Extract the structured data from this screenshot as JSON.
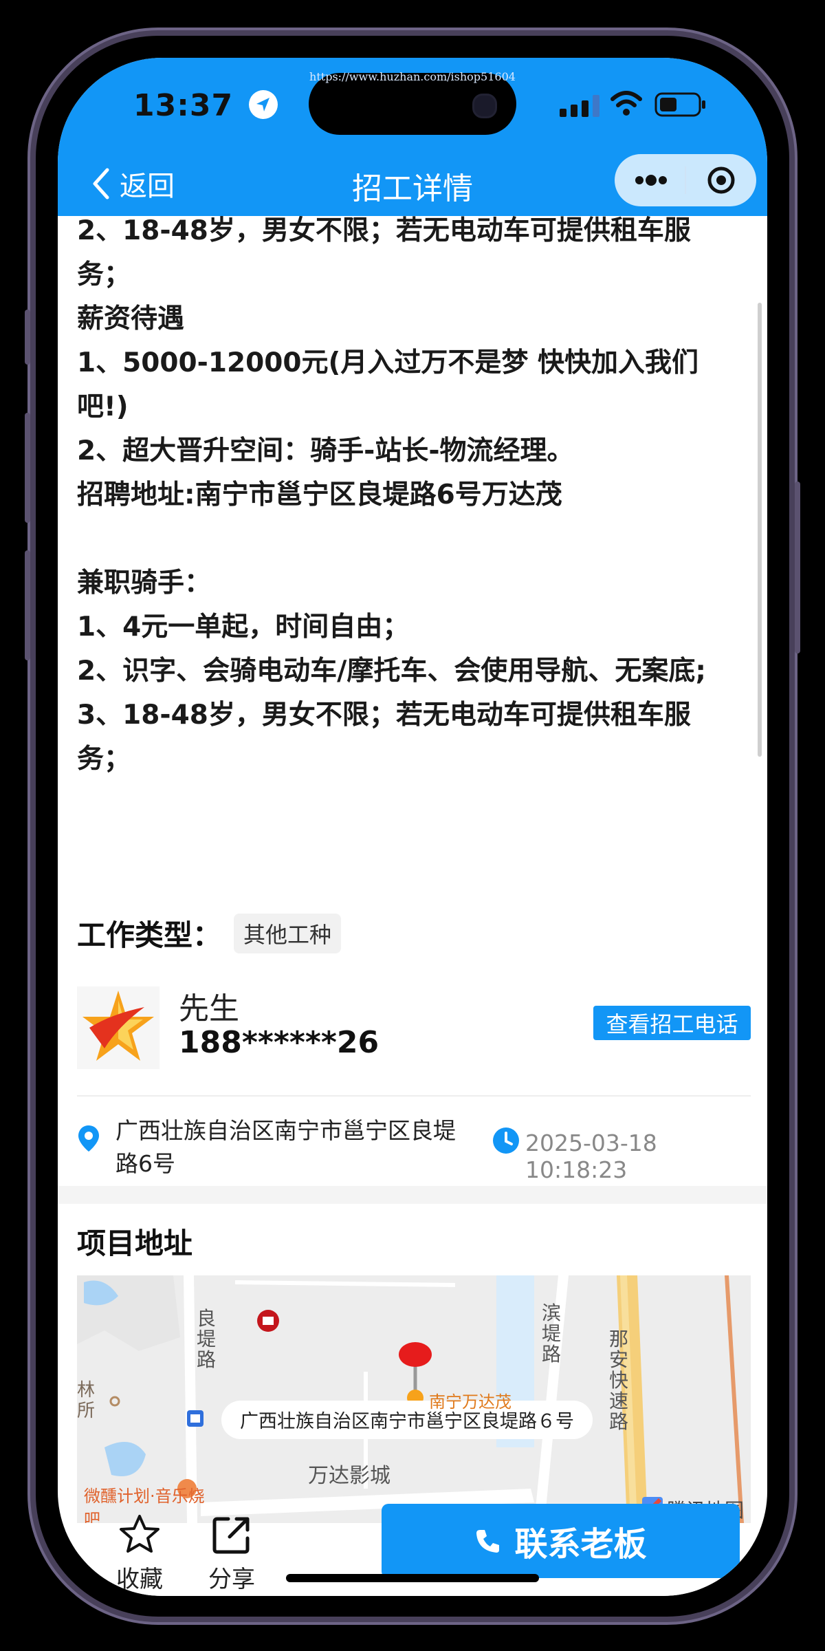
{
  "status": {
    "time": "13:37",
    "url": "https://www.huzhan.com/ishop51604"
  },
  "nav": {
    "back_label": "返回",
    "title": "招工详情"
  },
  "description": "2、18-48岁，男女不限；若无电动车可提供租车服务；\n薪资待遇\n1、5000-12000元(月入过万不是梦 快快加入我们吧!)\n2、超大晋升空间：骑手-站长-物流经理。\n招聘地址:南宁市邕宁区良堤路6号万达茂\n\n兼职骑手：\n1、4元一单起，时间自由；\n2、识字、会骑电动车/摩托车、会使用导航、无案底;\n3、18-48岁，男女不限；若无电动车可提供租车服务；",
  "work_type": {
    "label": "工作类型：",
    "value": "其他工种"
  },
  "contact": {
    "name": "先生",
    "phone": "188******26",
    "call_button": "查看招工电话"
  },
  "location": {
    "address": "广西壮族自治区南宁市邕宁区良堤路6号",
    "datetime": "2025-03-18 10:18:23"
  },
  "project": {
    "title": "项目地址"
  },
  "map": {
    "callout": "广西壮族自治区南宁市邕宁区良堤路６号",
    "labels": {
      "road1": "良堤路",
      "road2": "滨堤路",
      "road3": "那安快速路",
      "cinema": "万达影城",
      "poi1": "林所",
      "poi2": "微醺计划·音乐烧吧",
      "poi3": "南宁万达茂",
      "brand": "腾讯地图"
    }
  },
  "bottom": {
    "favorite": "收藏",
    "share": "分享",
    "contact": "联系老板"
  },
  "colors": {
    "primary": "#1296f6",
    "text": "#1a1a1a"
  }
}
